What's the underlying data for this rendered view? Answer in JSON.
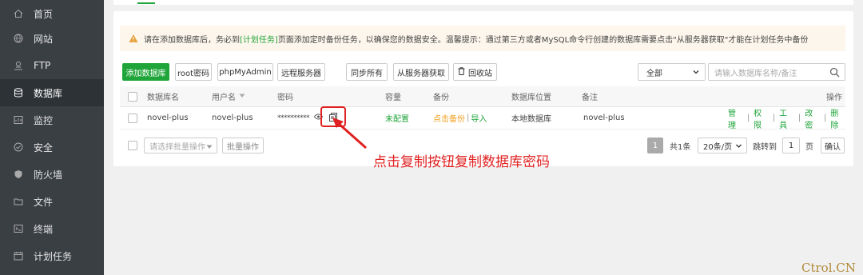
{
  "sidebar": {
    "items": [
      {
        "label": "首页",
        "icon": "home-icon"
      },
      {
        "label": "网站",
        "icon": "globe-icon"
      },
      {
        "label": "FTP",
        "icon": "ftp-icon"
      },
      {
        "label": "数据库",
        "icon": "database-icon",
        "active": true
      },
      {
        "label": "监控",
        "icon": "monitor-icon"
      },
      {
        "label": "安全",
        "icon": "shield-icon"
      },
      {
        "label": "防火墙",
        "icon": "firewall-icon"
      },
      {
        "label": "文件",
        "icon": "folder-icon"
      },
      {
        "label": "终端",
        "icon": "terminal-icon"
      },
      {
        "label": "计划任务",
        "icon": "calendar-icon"
      }
    ]
  },
  "notice": {
    "part1": "请在添加数据库后，务必到",
    "link": "[计划任务]",
    "part2": "页面添加定时备份任务，以确保您的数据安全。温馨提示：通过第三方或者MySQL命令行创建的数据库需要点击\"从服务器获取\"才能在计划任务中备份"
  },
  "toolbar": {
    "add_db": "添加数据库",
    "root_pwd": "root密码",
    "phpmyadmin": "phpMyAdmin",
    "remote": "远程服务器",
    "sync_all": "同步所有",
    "fetch_server": "从服务器获取",
    "recycle": "回收站",
    "filter_value": "全部",
    "search_placeholder": "请输入数据库名称/备注"
  },
  "table": {
    "headers": {
      "name": "数据库名",
      "user": "用户名",
      "password": "密码",
      "capacity": "容量",
      "backup": "备份",
      "location": "数据库位置",
      "remark": "备注",
      "ops": "操作"
    },
    "rows": [
      {
        "name": "novel-plus",
        "user": "novel-plus",
        "password": "**********",
        "capacity": "未配置",
        "backup_link": "点击备份",
        "backup_sep": "|",
        "import_link": "导入",
        "location": "本地数据库",
        "remark": "novel-plus",
        "ops": [
          "管理",
          "权限",
          "工具",
          "改密",
          "删除"
        ]
      }
    ]
  },
  "footer": {
    "batch_placeholder": "请选择批量操作",
    "batch_btn": "批量操作",
    "current_page": "1",
    "total": "共1条",
    "per_page": "20条/页",
    "jump_label": "跳转到",
    "jump_value": "1",
    "page_unit": "页",
    "confirm": "确认"
  },
  "annotation": {
    "text": "点击复制按钮复制数据库密码"
  },
  "watermark": "Ctrol.CN",
  "colors": {
    "accent": "#20a53a",
    "annotation": "#e02020",
    "sidebar": "#3a3f44"
  }
}
